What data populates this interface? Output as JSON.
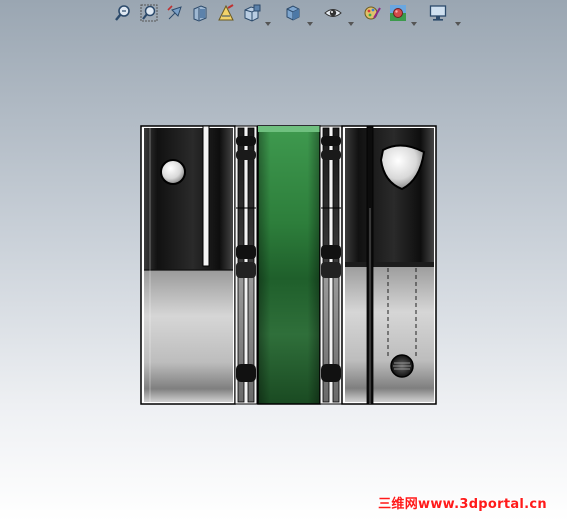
{
  "toolbar": {
    "buttons": [
      {
        "name": "zoom-to-fit-button",
        "icon": "zoom-to-fit-icon"
      },
      {
        "name": "zoom-to-area-button",
        "icon": "zoom-to-area-icon"
      },
      {
        "name": "previous-view-button",
        "icon": "previous-view-icon"
      },
      {
        "name": "section-view-button",
        "icon": "section-view-icon"
      },
      {
        "name": "dynamic-annotation-views-button",
        "icon": "annotation-views-icon"
      },
      {
        "name": "view-orientation-button",
        "icon": "view-orientation-icon"
      },
      {
        "name": "display-style-button",
        "icon": "display-style-icon"
      },
      {
        "name": "hide-show-items-button",
        "icon": "eye-icon"
      },
      {
        "name": "edit-appearance-button",
        "icon": "edit-appearance-icon"
      },
      {
        "name": "apply-scene-button",
        "icon": "apply-scene-icon"
      },
      {
        "name": "view-settings-button",
        "icon": "monitor-icon"
      }
    ]
  },
  "model": {
    "description_colors": {
      "hub_dark": "#1d1d1d",
      "hub_metal": "#c9c9c9",
      "spacer_green": "#2f8a3e",
      "outline": "#000000"
    }
  },
  "watermark": {
    "text": "三维网www.3dportal.cn",
    "color": "#ff1a1a"
  }
}
